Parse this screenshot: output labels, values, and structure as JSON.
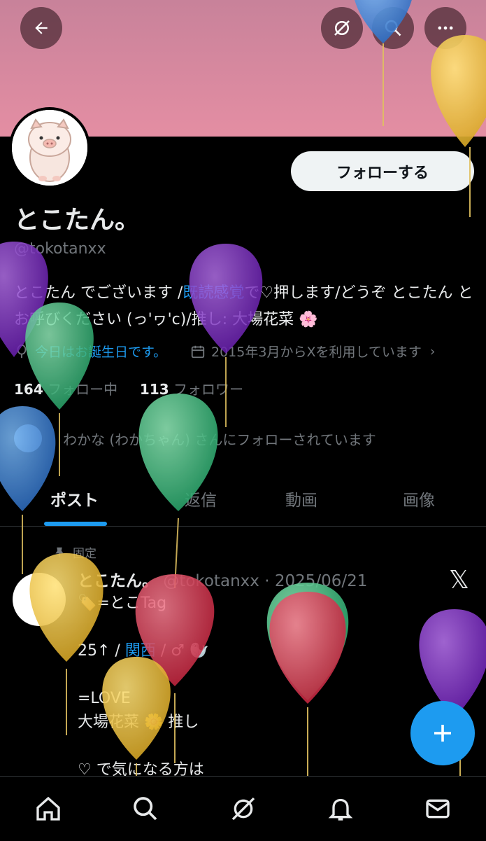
{
  "profile": {
    "name": "とこたん。",
    "handle": "@tokotanxx",
    "bio_part1": "とこたん でございます /",
    "bio_link1": "既読感覚",
    "bio_part2": "で♡押します/どうぞ とこたん とお呼びください (っ'ヮ'c)/推し: 大場花菜 ",
    "bio_emoji": "🌸",
    "birthday_icon": "balloon-icon",
    "birthday": "今日はお誕生日です。",
    "joined_icon": "calendar-icon",
    "joined": "2015年3月からXを利用しています",
    "following_count": "164",
    "following_label": "フォロー中",
    "followers_count": "113",
    "followers_label": "フォロワー",
    "followed_by": "わかな (わかちゃん) さんにフォローされています"
  },
  "actions": {
    "follow_label": "フォローする",
    "back_icon": "back-arrow-icon",
    "grok_icon": "grok-icon",
    "search_icon": "search-icon",
    "more_icon": "more-icon"
  },
  "tabs": [
    "ポスト",
    "返信",
    "動画",
    "画像"
  ],
  "post": {
    "pinned_label": "固定",
    "author": "とこたん。",
    "meta": "@tokotanxx · 2025/06/21",
    "line1_tag": "🏷️",
    "line1_text": "=とこTag",
    "line2a": "25↑ / ",
    "line2_link": "関西",
    "line2b": " / ♂ 🦭",
    "line3": "=LOVE",
    "line4": "大場花菜 🌼 推し",
    "line5": "♡ で気になる方は",
    "x_logo": "𝕏"
  },
  "colors": {
    "accent": "#1d9bf0",
    "banner": "#e48ea3"
  }
}
